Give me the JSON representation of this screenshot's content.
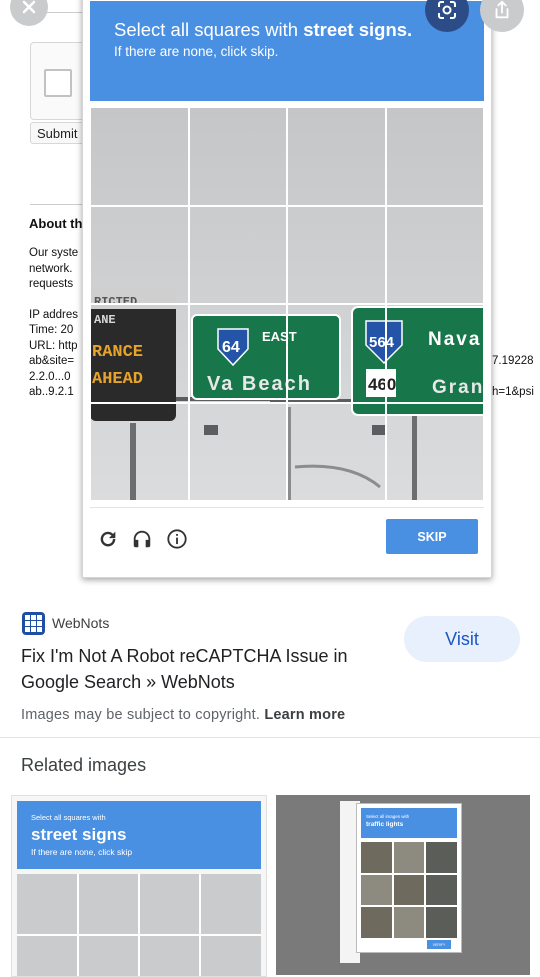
{
  "captcha": {
    "title_prefix": "Select all squares with ",
    "title_bold": "street signs.",
    "subtitle": "If there are none, click skip.",
    "skip_label": "SKIP",
    "sign_left": [
      "RICTED",
      "ANE",
      "RANCE",
      "AHEAD"
    ],
    "sign_middle": {
      "route": "64",
      "direction": "EAST",
      "destination": "Va Beach"
    },
    "sign_right": {
      "route": "564",
      "route2": "460",
      "line1": "Nava",
      "line2": "Gran"
    }
  },
  "background_page": {
    "submit_label": "Submit",
    "about_heading": "About th",
    "text_lines": [
      "Our syste",
      "network.",
      "requests",
      "",
      "IP addres",
      "Time: 20",
      "URL: http",
      "ab&site=",
      "2.2.0...0",
      "ab..9.2.1"
    ],
    "right_fragments": [
      "7.19228",
      "h=1&psi"
    ]
  },
  "result": {
    "site_name": "WebNots",
    "visit_label": "Visit",
    "title": "Fix I'm Not A Robot reCAPTCHA Issue in Google Search » WebNots",
    "copyright_text": "Images may be subject to copyright. ",
    "learn_more": "Learn more"
  },
  "related": {
    "heading": "Related images",
    "thumb1": {
      "line1": "Select all squares with",
      "line2": "street signs",
      "line3": "If there are none, click skip"
    },
    "thumb2": {
      "line1": "Select all images with",
      "line2": "traffic lights",
      "button": "VERIFY"
    }
  },
  "colors": {
    "captcha_blue": "#4a90e2",
    "sign_green": "#17764a",
    "visit_bg": "#e8f0fe",
    "visit_text": "#1a56c5"
  },
  "icons": [
    "close-icon",
    "lens-icon",
    "share-icon",
    "reload-icon",
    "headphones-icon",
    "info-icon",
    "site-grid-icon"
  ]
}
